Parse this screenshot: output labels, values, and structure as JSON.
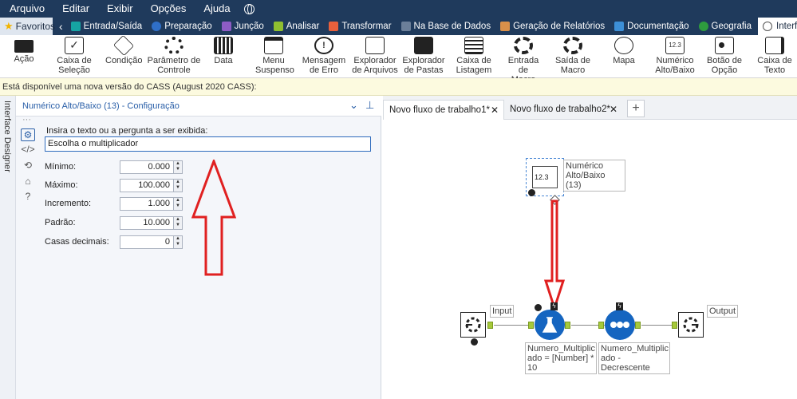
{
  "menu": [
    "Arquivo",
    "Editar",
    "Exibir",
    "Opções",
    "Ajuda"
  ],
  "categories": {
    "favorites": "Favoritos",
    "items": [
      {
        "label": "Entrada/Saída",
        "color": "#16a3a3"
      },
      {
        "label": "Preparação",
        "color": "#2f6fc8"
      },
      {
        "label": "Junção",
        "color": "#8d5cc4"
      },
      {
        "label": "Analisar",
        "color": "#8fbf30"
      },
      {
        "label": "Transformar",
        "color": "#e8603c"
      },
      {
        "label": "Na Base de Dados",
        "color": "#6b7f99"
      },
      {
        "label": "Geração de Relatórios",
        "color": "#d9904a"
      },
      {
        "label": "Documentação",
        "color": "#3d8fd6"
      },
      {
        "label": "Geografia",
        "color": "#2e9c3e"
      }
    ],
    "active": "Interface"
  },
  "tools": [
    {
      "line1": "Ação",
      "line2": "",
      "icon": "action-icon"
    },
    {
      "line1": "Caixa de",
      "line2": "Seleção",
      "icon": "checkbox-icon"
    },
    {
      "line1": "Condição",
      "line2": "",
      "icon": "condition-icon"
    },
    {
      "line1": "Parâmetro de",
      "line2": "Controle",
      "icon": "control-parameter-icon"
    },
    {
      "line1": "Data",
      "line2": "",
      "icon": "date-icon"
    },
    {
      "line1": "Menu",
      "line2": "Suspenso",
      "icon": "dropdown-icon"
    },
    {
      "line1": "Mensagem",
      "line2": "de Erro",
      "icon": "error-message-icon"
    },
    {
      "line1": "Explorador",
      "line2": "de Arquivos",
      "icon": "file-browse-icon"
    },
    {
      "line1": "Explorador",
      "line2": "de Pastas",
      "icon": "folder-browse-icon"
    },
    {
      "line1": "Caixa de",
      "line2": "Listagem",
      "icon": "list-box-icon"
    },
    {
      "line1": "Entrada de",
      "line2": "Macro",
      "icon": "macro-input-icon"
    },
    {
      "line1": "Saída de",
      "line2": "Macro",
      "icon": "macro-output-icon"
    },
    {
      "line1": "Mapa",
      "line2": "",
      "icon": "map-icon"
    },
    {
      "line1": "Numérico",
      "line2": "Alto/Baixo",
      "icon": "numeric-updown-icon",
      "glyph": "12.3"
    },
    {
      "line1": "Botão de",
      "line2": "Opção",
      "icon": "radio-button-icon"
    },
    {
      "line1": "Caixa de",
      "line2": "Texto",
      "icon": "text-box-icon"
    }
  ],
  "info_bar": "Está disponível uma nova versão do CASS (August 2020 CASS):",
  "side_panel_title": "Interface Designer",
  "config": {
    "title": "Numérico Alto/Baixo (13) - Configuração",
    "prompt_label": "Insira o texto ou a pergunta a ser exibida:",
    "prompt_value": "Escolha o multiplicador",
    "fields": [
      {
        "label": "Mínimo:",
        "value": "0.000"
      },
      {
        "label": "Máximo:",
        "value": "100.000"
      },
      {
        "label": "Incremento:",
        "value": "1.000"
      },
      {
        "label": "Padrão:",
        "value": "10.000"
      },
      {
        "label": "Casas decimais:",
        "value": "0"
      }
    ]
  },
  "workflow_tabs": [
    {
      "label": "Novo fluxo de trabalho1*",
      "active": true
    },
    {
      "label": "Novo fluxo de trabalho2*",
      "active": false
    }
  ],
  "nodes": {
    "numeric_tool_glyph": "12.3",
    "numeric_label": [
      "Numérico",
      "Alto/Baixo (13)"
    ],
    "input_label": "Input",
    "output_label": "Output",
    "formula_label": [
      "Numero_Multiplic",
      "ado = [Number] *",
      "10"
    ],
    "sort_label": [
      "Numero_Multiplic",
      "ado - Decrescente"
    ]
  },
  "colors": {
    "menubar": "#1f3a5c",
    "accent": "#2a5fa8",
    "arrow_red": "#e02020",
    "anchor_green": "#a6c93a",
    "tool_blue": "#1565c0",
    "info_bg": "#fcfadf"
  }
}
